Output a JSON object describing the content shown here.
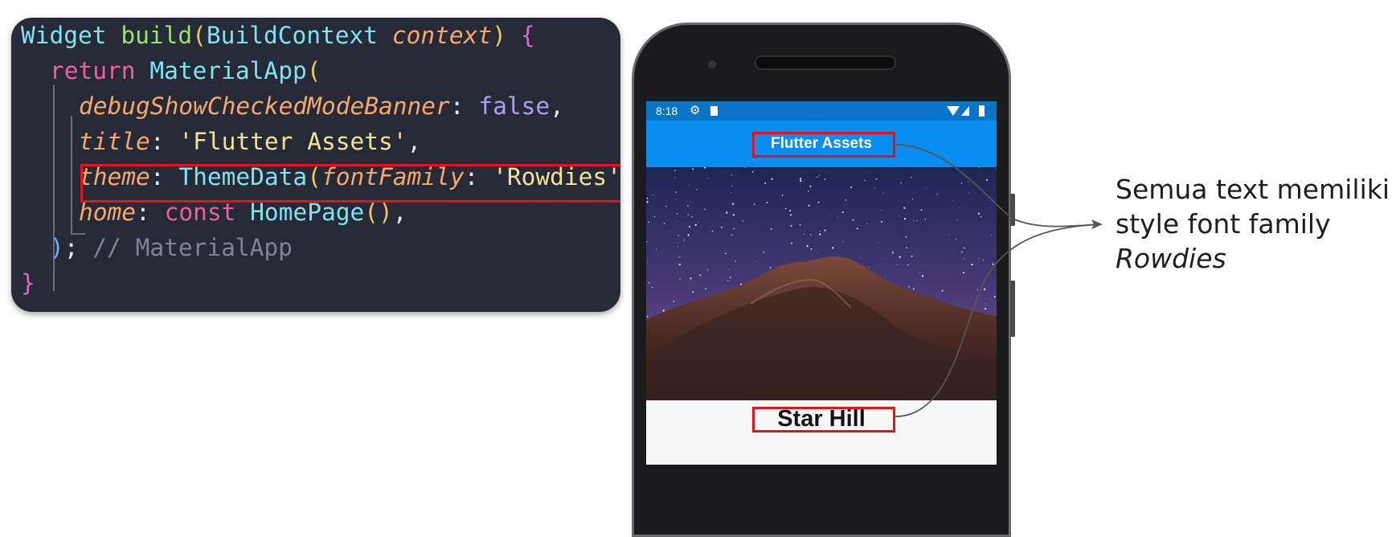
{
  "code": {
    "line1": {
      "kw_widget": "Widget",
      "fn_build": "build",
      "lparen": "(",
      "type_ctx": "BuildContext",
      "param": "context",
      "rparen": ")",
      "brace_open": "{"
    },
    "line2": {
      "kw_return": "return",
      "type_app": "MaterialApp",
      "lparen": "("
    },
    "line3": {
      "field": "debugShowCheckedModeBanner",
      "colon": ":",
      "value": "false",
      "comma": ","
    },
    "line4": {
      "field": "title",
      "colon": ":",
      "value": "'Flutter Assets'",
      "comma": ","
    },
    "line5": {
      "field": "theme",
      "colon": ":",
      "type": "ThemeData",
      "lparen": "(",
      "param": "fontFamily",
      "colon2": ":",
      "value": "'Rowdies'",
      "rparen": ")",
      "comma": ","
    },
    "line6": {
      "field": "home",
      "colon": ":",
      "kw_const": "const",
      "type": "HomePage",
      "parens": "()",
      "comma": ","
    },
    "line7": {
      "rparen": ")",
      "semi": ";",
      "comment": "// MaterialApp"
    },
    "line8": {
      "brace_close": "}"
    }
  },
  "phone": {
    "status_time": "8:18",
    "appbar_title": "Flutter Assets",
    "body_title": "Star Hill",
    "hero_image": "night-sky-mountain"
  },
  "annotation": {
    "line1": "Semua text memiliki",
    "line2": "style font family",
    "line3": "Rowdies"
  },
  "colors": {
    "code_bg": "#262a36",
    "highlight_red": "#e8101a",
    "appbar_blue": "#0a8df0",
    "statusbar_blue": "#0a74c7"
  }
}
